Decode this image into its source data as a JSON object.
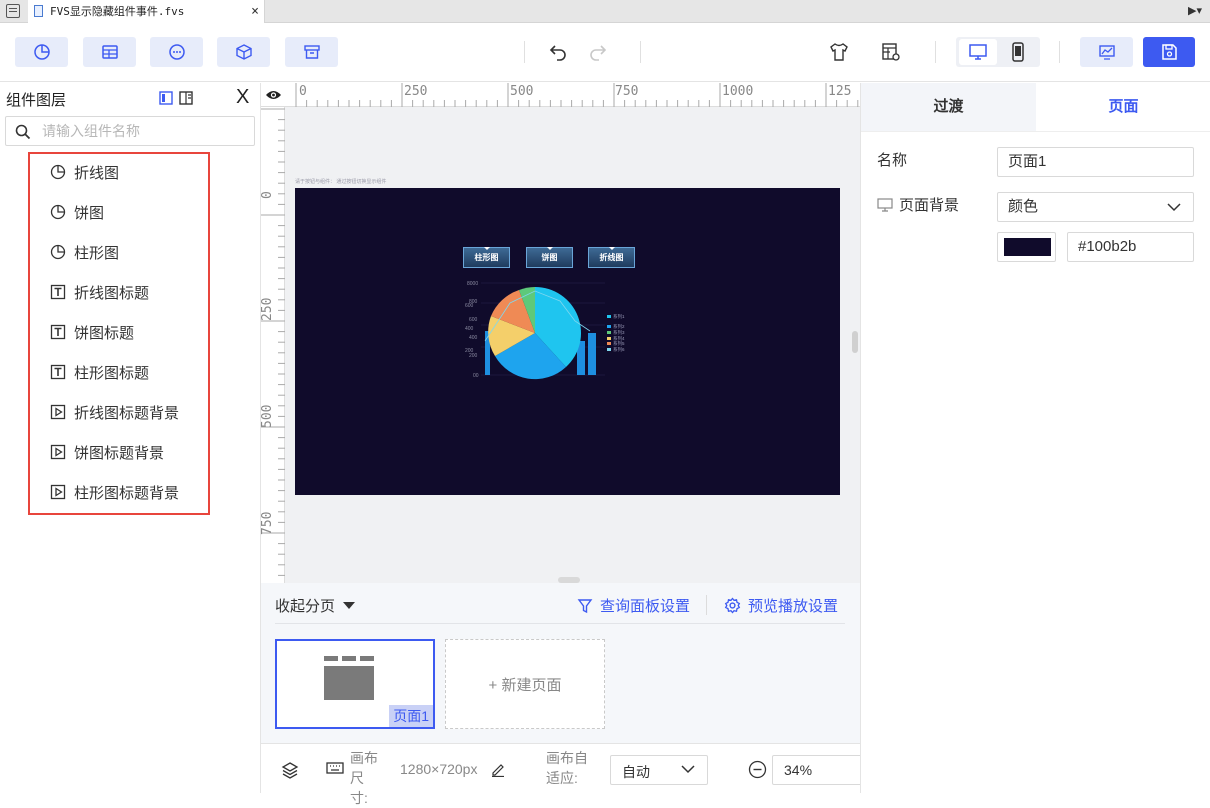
{
  "tab": {
    "filename": "FVS显示隐藏组件事件.fvs",
    "close": "×",
    "corner": "▶▾"
  },
  "colors": {
    "accent": "#3d5af1",
    "canvas_bg": "#100b2b",
    "highlight": "#e8453c"
  },
  "toolbar": {
    "left_buttons": [
      "chart-icon",
      "table-icon",
      "more-icon",
      "component-icon",
      "archive-icon"
    ],
    "undo": "undo-icon",
    "redo": "redo-icon"
  },
  "left_panel": {
    "title": "组件图层",
    "close": "X",
    "search_placeholder": "请输入组件名称",
    "layers": [
      {
        "label": "折线图",
        "icon": "chart-icon"
      },
      {
        "label": "饼图",
        "icon": "chart-icon"
      },
      {
        "label": "柱形图",
        "icon": "chart-icon"
      },
      {
        "label": "折线图标题",
        "icon": "text-icon"
      },
      {
        "label": "饼图标题",
        "icon": "text-icon"
      },
      {
        "label": "柱形图标题",
        "icon": "text-icon"
      },
      {
        "label": "折线图标题背景",
        "icon": "media-icon"
      },
      {
        "label": "饼图标题背景",
        "icon": "media-icon"
      },
      {
        "label": "柱形图标题背景",
        "icon": "media-icon"
      }
    ]
  },
  "ruler": {
    "top": [
      "0",
      "250",
      "500",
      "750",
      "1000",
      "125"
    ],
    "left": [
      "0",
      "250",
      "500",
      "750"
    ]
  },
  "canvas": {
    "caption": "请于按钮与组件： 通过按钮切换显示组件",
    "nav_buttons": [
      "柱形图",
      "饼图",
      "折线图"
    ],
    "mini_chart": {
      "yticks": [
        "8000",
        "800",
        "600",
        "600",
        "400",
        "400",
        "200",
        "200",
        "00"
      ],
      "legend": [
        "系列1",
        "系列2",
        "系列3",
        "系列4",
        "系列5",
        "系列6"
      ]
    }
  },
  "page_bar": {
    "collapse_label": "收起分页",
    "query_panel_label": "查询面板设置",
    "preview_label": "预览播放设置",
    "page_name": "页面1",
    "new_page_label": "+ 新建页面"
  },
  "status_bar": {
    "canvas_size_label": "画布尺寸:",
    "canvas_size_value": "1280×720px",
    "adapt_label": "画布自适应:",
    "adapt_value": "自动",
    "zoom_value": "34%"
  },
  "right_panel": {
    "tabs": [
      "过渡",
      "页面"
    ],
    "name_label": "名称",
    "name_value": "页面1",
    "bg_label": "页面背景",
    "bg_type": "颜色",
    "bg_hex": "#100b2b"
  }
}
